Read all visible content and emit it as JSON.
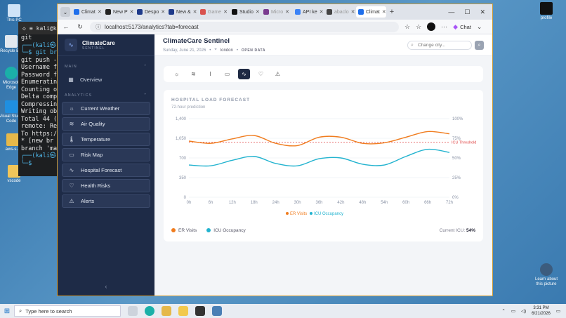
{
  "desktop": {
    "icons_left": [
      {
        "label": "This PC"
      },
      {
        "label": "Recycle Bin"
      },
      {
        "label": "Microsoft Edge"
      },
      {
        "label": "Visual Studio Code"
      },
      {
        "label": "aws-s..."
      },
      {
        "label": "vscode"
      }
    ],
    "icons_right": [
      {
        "label": "profile"
      },
      {
        "label": "Learn about this picture"
      }
    ]
  },
  "terminal": {
    "title": "kali@k",
    "lines": [
      "git",
      "┌──(kali㉿",
      "└─$ git br",
      "git push -",
      "Username f",
      "Password f",
      "Enumeratin",
      "Counting o",
      "Delta comp",
      "Compressin",
      "Writing ob",
      "Total 44 (",
      "remote: Re",
      "To https:/",
      " * [new br",
      "branch 'ma",
      "┌──(kali㉿",
      "└─$"
    ]
  },
  "browser": {
    "tabs": [
      {
        "label": "Climat",
        "color": "#1f6feb",
        "active": false
      },
      {
        "label": "New P",
        "color": "#222222",
        "active": false
      },
      {
        "label": "Despo",
        "color": "#1e3a8a",
        "active": false
      },
      {
        "label": "New &",
        "color": "#1e3a8a",
        "active": false
      },
      {
        "label": "Game",
        "color": "#d9534f",
        "active": false
      },
      {
        "label": "Studio",
        "color": "#111111",
        "active": false
      },
      {
        "label": "Micro",
        "color": "#7a3b8f",
        "active": false
      },
      {
        "label": "API ke",
        "color": "#3b82f6",
        "active": false
      },
      {
        "label": "abaclo",
        "color": "#444444",
        "active": false
      },
      {
        "label": "Climat",
        "color": "#1f6feb",
        "active": true
      }
    ],
    "url": "localhost:5173/analytics?tab=forecast",
    "chat_label": "Chat"
  },
  "app": {
    "brand_name": "ClimateCare",
    "brand_sub": "SENTINEL",
    "main_label": "MAIN",
    "analytics_label": "ANALYTICS",
    "overview": "Overview",
    "nav": [
      {
        "label": "Current Weather",
        "icon": "sun-icon"
      },
      {
        "label": "Air Quality",
        "icon": "wind-icon"
      },
      {
        "label": "Temperature",
        "icon": "thermometer-icon"
      },
      {
        "label": "Risk Map",
        "icon": "map-icon"
      },
      {
        "label": "Hospital Forecast",
        "icon": "activity-icon"
      },
      {
        "label": "Health Risks",
        "icon": "heart-icon"
      },
      {
        "label": "Alerts",
        "icon": "warning-icon"
      }
    ],
    "title": "ClimateCare Sentinel",
    "date": "Sunday, June 21, 2026",
    "city": "london",
    "open_data": "OPEN DATA",
    "search_placeholder": "Change city..."
  },
  "card": {
    "title": "HOSPITAL LOAD FORECAST",
    "subtitle": "72-hour prediction",
    "legend_er": "ER Visits",
    "legend_icu": "ICU Occupancy",
    "current_icu_label": "Current ICU:",
    "current_icu_value": "54%"
  },
  "chart_data": {
    "type": "line",
    "x": [
      "0h",
      "6h",
      "12h",
      "18h",
      "24h",
      "30h",
      "36h",
      "42h",
      "48h",
      "54h",
      "60h",
      "66h",
      "72h"
    ],
    "series": [
      {
        "name": "ER Visits",
        "axis": "left",
        "color": "#f07c1e",
        "values": [
          1000,
          960,
          1040,
          1100,
          960,
          920,
          1070,
          1070,
          960,
          970,
          1070,
          1170,
          1130
        ]
      },
      {
        "name": "ICU Occupancy",
        "axis": "right",
        "color": "#22b3cf",
        "values": [
          41,
          40,
          47,
          52,
          43,
          40,
          49,
          50,
          42,
          41,
          52,
          61,
          57
        ]
      }
    ],
    "left_ticks": [
      "1,400",
      "1,050",
      "700",
      "350",
      "0"
    ],
    "right_ticks": [
      "100%",
      "75%",
      "50%",
      "25%",
      "0%"
    ],
    "ylim_left": [
      0,
      1400
    ],
    "ylim_right": [
      0,
      100
    ],
    "threshold": {
      "label": "ICU Threshold",
      "value": 70,
      "axis": "right",
      "color": "#e04848"
    }
  },
  "taskbar": {
    "search_placeholder": "Type here to search",
    "time": "3:31 PM",
    "date": "6/21/2026"
  }
}
